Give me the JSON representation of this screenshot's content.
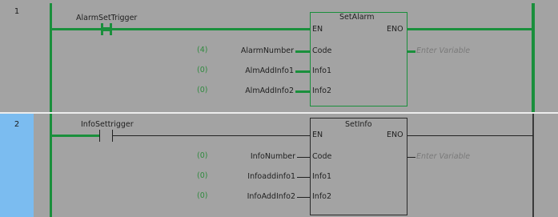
{
  "rungs": [
    {
      "number": "1",
      "contact_label": "AlarmSetTrigger",
      "block_title": "SetAlarm",
      "pin_en": "EN",
      "pin_eno": "ENO",
      "eno_output": "Enter Variable",
      "inputs": [
        {
          "num": "(4)",
          "variable": "AlarmNumber",
          "pin": "Code"
        },
        {
          "num": "(0)",
          "variable": "AlmAddInfo1",
          "pin": "Info1"
        },
        {
          "num": "(0)",
          "variable": "AlmAddInfo2",
          "pin": "Info2"
        }
      ]
    },
    {
      "number": "2",
      "contact_label": "InfoSettrigger",
      "block_title": "SetInfo",
      "pin_en": "EN",
      "pin_eno": "ENO",
      "eno_output": "Enter Variable",
      "inputs": [
        {
          "num": "(0)",
          "variable": "InfoNumber",
          "pin": "Code"
        },
        {
          "num": "(0)",
          "variable": "Infoaddinfo1",
          "pin": "Info1"
        },
        {
          "num": "(0)",
          "variable": "InfoAddInfo2",
          "pin": "Info2"
        }
      ]
    }
  ],
  "colors": {
    "energized": "#1a8f3c",
    "deenergized": "#3a3a3a",
    "selected_rung": "#7bbcf0",
    "background": "#a3a3a3"
  }
}
